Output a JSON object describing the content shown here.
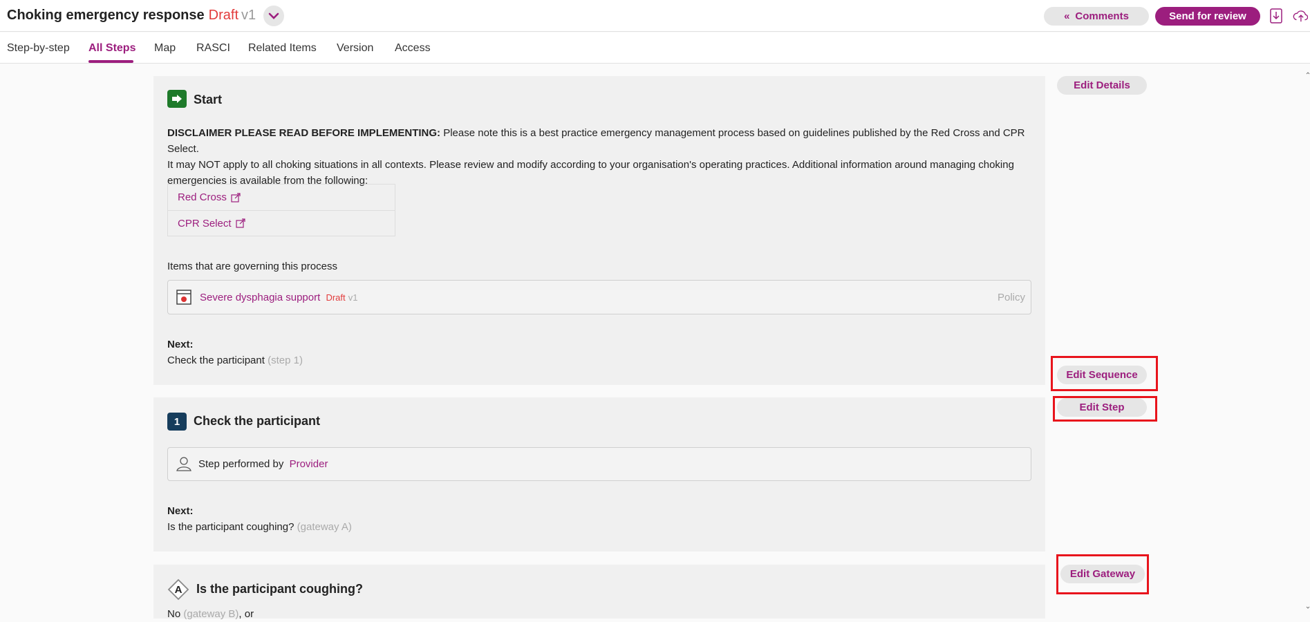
{
  "header": {
    "title": "Choking emergency response",
    "status": "Draft",
    "version": "v1",
    "comments_label": "Comments",
    "send_review_label": "Send for review"
  },
  "tabs": [
    {
      "label": "Step-by-step"
    },
    {
      "label": "All Steps"
    },
    {
      "label": "Map"
    },
    {
      "label": "RASCI"
    },
    {
      "label": "Related Items"
    },
    {
      "label": "Version"
    },
    {
      "label": "Access"
    }
  ],
  "start": {
    "title": "Start",
    "disclaimer_bold": "DISCLAIMER PLEASE READ BEFORE IMPLEMENTING:",
    "disclaimer_line1": "Please note this is a best practice emergency management process based on guidelines published by the Red Cross and CPR Select.",
    "disclaimer_line2": "It may NOT apply to all choking situations in all contexts. Please review and modify according to your organisation's operating practices. Additional information around managing choking",
    "disclaimer_line3": "emergencies is available from the following:",
    "links": [
      "Red Cross",
      "CPR Select"
    ],
    "governing_label": "Items that are governing this process",
    "governing_item": {
      "name": "Severe dysphagia support",
      "status": "Draft",
      "version": "v1",
      "type": "Policy"
    },
    "next_label": "Next:",
    "next_text": "Check the participant",
    "next_ref": "(step 1)"
  },
  "step1": {
    "number": "1",
    "title": "Check the participant",
    "performed_by_label": "Step performed by",
    "performer": "Provider",
    "next_label": "Next:",
    "next_text": "Is the participant coughing?",
    "next_ref": "(gateway A)"
  },
  "gatewayA": {
    "letter": "A",
    "title": "Is the participant coughing?",
    "opt_text": "No",
    "opt_ref": "(gateway B)",
    "opt_suffix": ", or"
  },
  "side": {
    "edit_details": "Edit Details",
    "edit_sequence": "Edit Sequence",
    "edit_step": "Edit Step",
    "edit_gateway": "Edit Gateway"
  },
  "colors": {
    "accent": "#9c1e7e",
    "draft": "#e23b3b",
    "highlight": "#e8141c"
  }
}
